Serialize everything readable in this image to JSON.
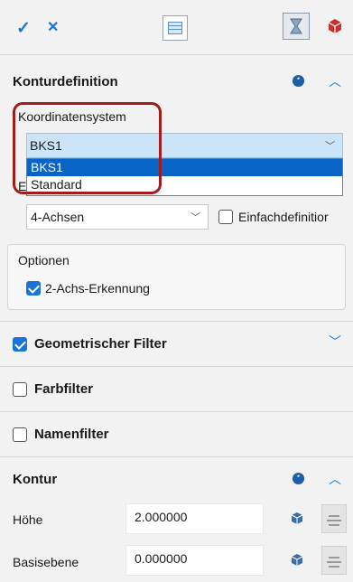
{
  "toolbar": {
    "ok_icon": "check-icon",
    "cancel_icon": "close-icon"
  },
  "kontur_def": {
    "title": "Konturdefinition",
    "koord_label": "Koordinatensystem",
    "koord_value": "BKS1",
    "dropdown_options": [
      "BKS1",
      "Standard"
    ],
    "hidden_label_fragment": "E",
    "achsen_value": "4-Achsen",
    "einfach_label": "Einfachdefinitior",
    "optionen_label": "Optionen",
    "zwei_achs_label": "2-Achs-Erkennung"
  },
  "geo_filter": {
    "label": "Geometrischer Filter"
  },
  "farbfilter": {
    "label": "Farbfilter"
  },
  "namenfilter": {
    "label": "Namenfilter"
  },
  "kontur": {
    "title": "Kontur",
    "hoehe_label": "Höhe",
    "hoehe_value": "2.000000",
    "basis_label": "Basisebene",
    "basis_value": "0.000000"
  },
  "colors": {
    "accent": "#1a73d9",
    "highlight": "#0a64c8",
    "red_marker": "#a31c1c"
  }
}
